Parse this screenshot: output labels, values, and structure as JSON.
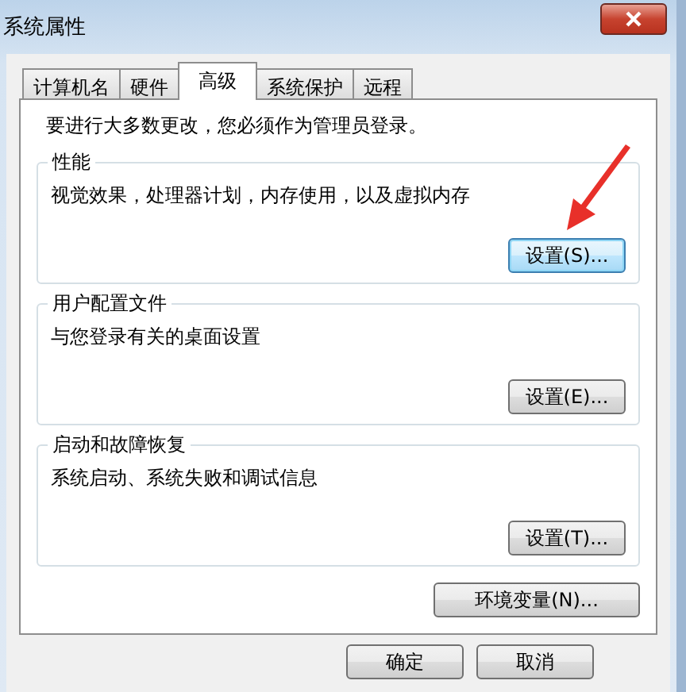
{
  "window": {
    "title": "系统属性"
  },
  "tabs": [
    {
      "label": "计算机名",
      "selected": false
    },
    {
      "label": "硬件",
      "selected": false
    },
    {
      "label": "高级",
      "selected": true
    },
    {
      "label": "系统保护",
      "selected": false
    },
    {
      "label": "远程",
      "selected": false
    }
  ],
  "notice": "要进行大多数更改，您必须作为管理员登录。",
  "groups": [
    {
      "title": "性能",
      "description": "视觉效果，处理器计划，内存使用，以及虚拟内存",
      "button": "设置(S)...",
      "focused": true
    },
    {
      "title": "用户配置文件",
      "description": "与您登录有关的桌面设置",
      "button": "设置(E)...",
      "focused": false
    },
    {
      "title": "启动和故障恢复",
      "description": "系统启动、系统失败和调试信息",
      "button": "设置(T)...",
      "focused": false
    }
  ],
  "env_button": "环境变量(N)...",
  "dialog_buttons": [
    "确定",
    "取消"
  ]
}
